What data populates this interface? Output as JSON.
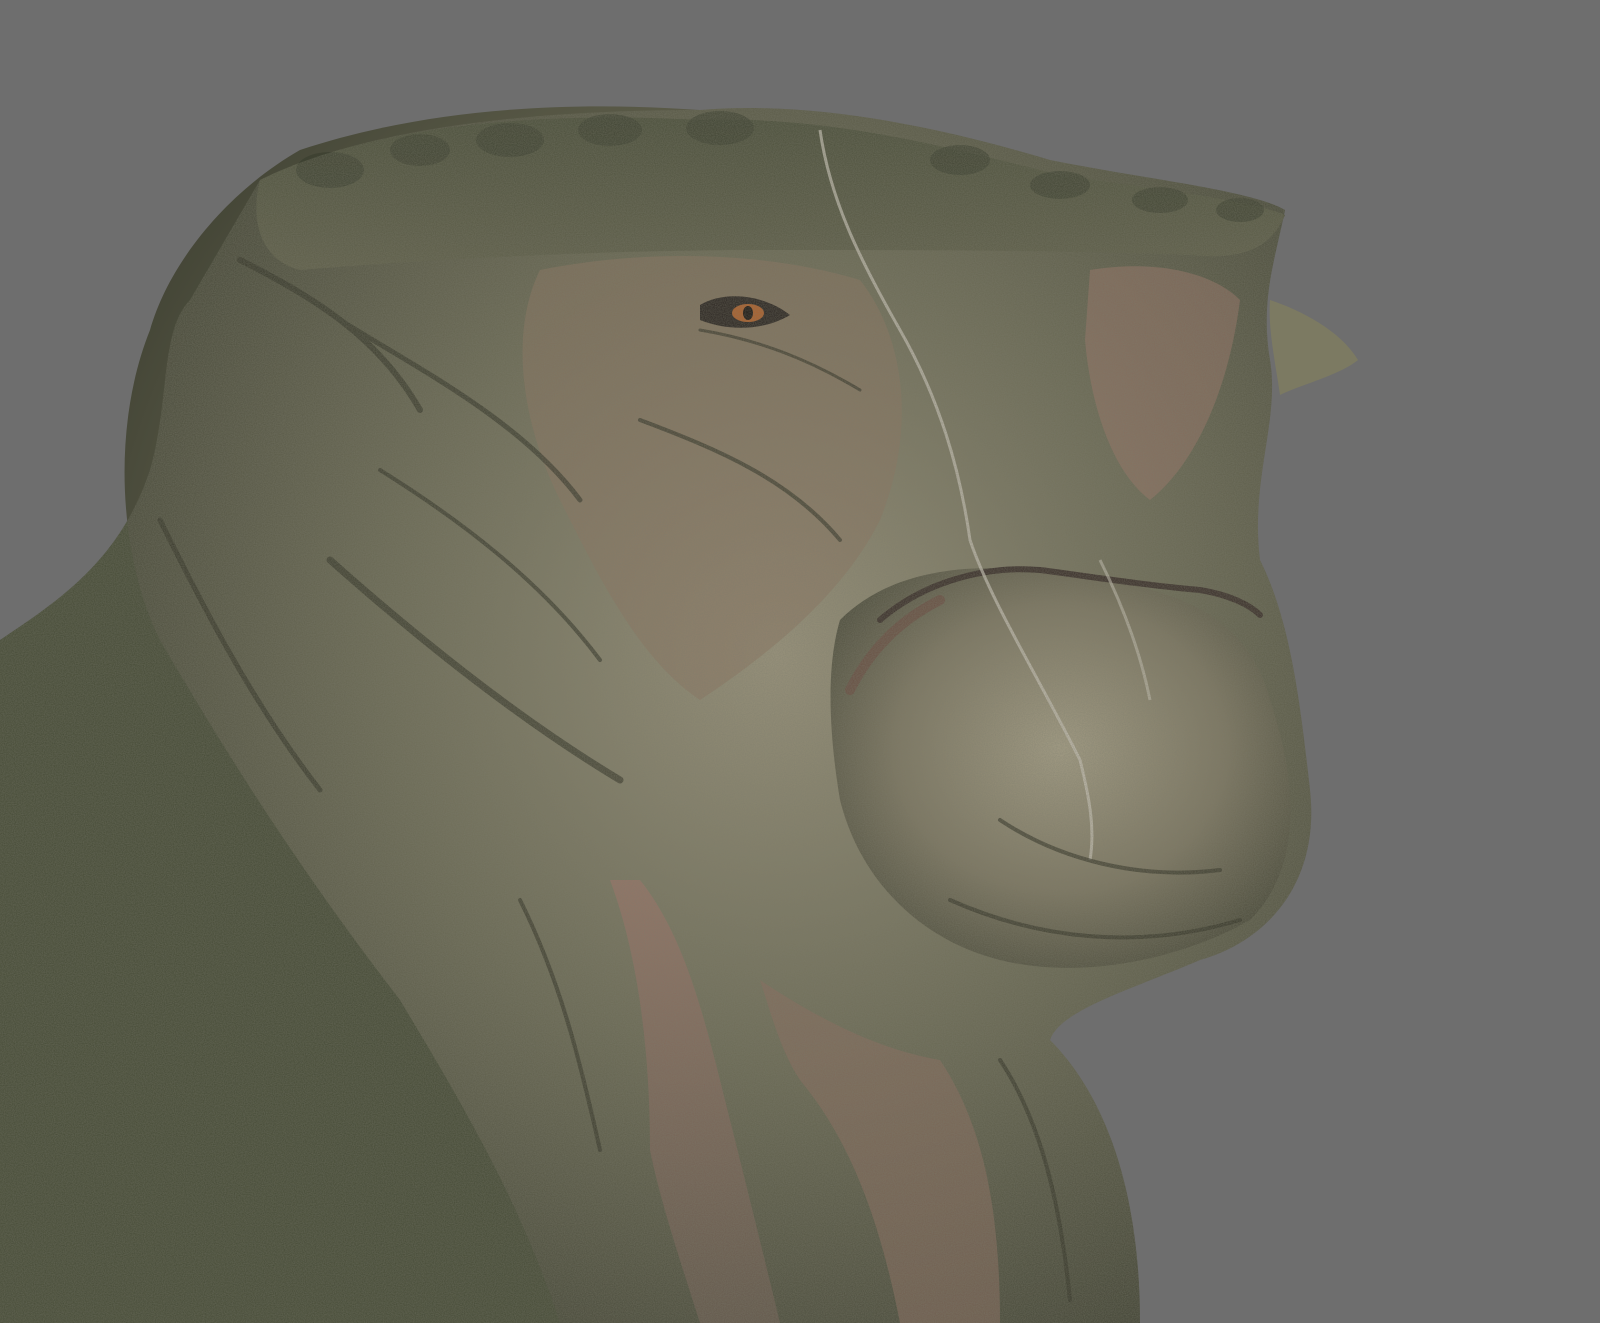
{
  "scene": {
    "subject_icon": "creature-head-icon",
    "background_color": "#6e6e6e",
    "colors": {
      "skin_dark": "#3f4331",
      "skin_mid": "#6b6a55",
      "skin_light": "#9a937c",
      "flesh_pink": "#9c7468",
      "eye": "#b0602a",
      "horn": "#7c7a62"
    }
  }
}
